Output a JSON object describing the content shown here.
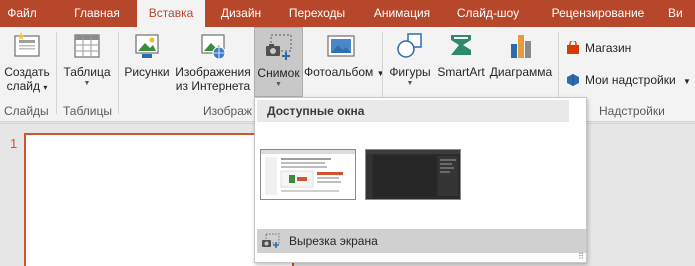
{
  "tabs": [
    {
      "label": "Файл",
      "active": false
    },
    {
      "label": "Главная",
      "active": false
    },
    {
      "label": "Вставка",
      "active": true
    },
    {
      "label": "Дизайн",
      "active": false
    },
    {
      "label": "Переходы",
      "active": false
    },
    {
      "label": "Анимация",
      "active": false
    },
    {
      "label": "Слайд-шоу",
      "active": false
    },
    {
      "label": "Рецензирование",
      "active": false
    },
    {
      "label": "Ви",
      "active": false
    }
  ],
  "ribbon": {
    "new_slide": {
      "line1": "Создать",
      "line2": "слайд",
      "caret": "▾"
    },
    "table": {
      "label": "Таблица"
    },
    "pictures": {
      "label": "Рисунки"
    },
    "online_pictures": {
      "line1": "Изображения",
      "line2": "из Интернета"
    },
    "screenshot": {
      "label": "Снимок"
    },
    "photo_album": {
      "label": "Фотоальбом"
    },
    "shapes": {
      "label": "Фигуры"
    },
    "smartart": {
      "label": "SmartArt"
    },
    "chart": {
      "label": "Диаграмма"
    },
    "store": {
      "label": "Магазин"
    },
    "my_addins": {
      "label": "Мои надстройки"
    },
    "groups": {
      "slides": "Слайды",
      "tables": "Таблицы",
      "images": "Изображ",
      "addins": "Надстройки"
    }
  },
  "slides": {
    "first_number": "1"
  },
  "dropdown": {
    "header": "Доступные окна",
    "screen_clipping": "Вырезка экрана"
  },
  "colors": {
    "accent": "#b7472a",
    "slide_border": "#d35230"
  }
}
